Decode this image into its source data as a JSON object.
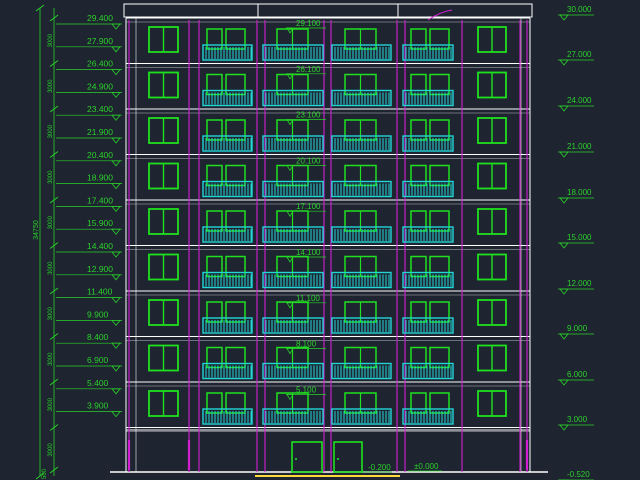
{
  "colors": {
    "background": "#1e2430",
    "wall": "#ffffff",
    "window": "#1fe01f",
    "balcony": "#22d6d6",
    "axis": "#d21fd2",
    "dimension": "#28d228",
    "level_text": "#2bd22b",
    "drop": "#ffd83a"
  },
  "left_levels": [
    "29.400",
    "27.900",
    "26.400",
    "24.900",
    "23.400",
    "21.900",
    "20.400",
    "18.900",
    "17.400",
    "15.900",
    "14.400",
    "12.900",
    "11.400",
    "9.900",
    "8.400",
    "6.900",
    "5.400",
    "3.900"
  ],
  "dimension_segments": [
    "3000",
    "3000",
    "3000",
    "3000",
    "3000",
    "3000",
    "3000",
    "3000",
    "3000"
  ],
  "total_dimension": "34750",
  "base_dimension": "3000",
  "bottom_dimension": "500",
  "center_levels": [
    "29.100",
    "26.100",
    "23.100",
    "20.100",
    "17.100",
    "14.100",
    "11.100",
    "8.100",
    "5.100"
  ],
  "right_levels": [
    "30.000",
    "27.000",
    "24.000",
    "21.000",
    "18.000",
    "15.000",
    "12.000",
    "9.000",
    "6.000",
    "3.000",
    "-0.520"
  ],
  "ground_labels": {
    "minus": "-0.200",
    "zero": "±0.000"
  }
}
